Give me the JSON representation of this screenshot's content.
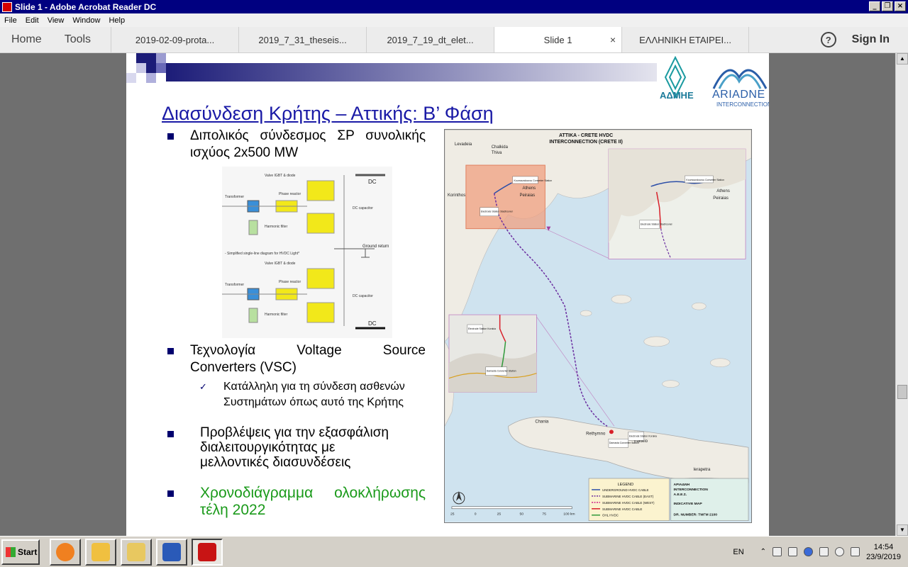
{
  "window": {
    "title": "Slide 1 - Adobe Acrobat Reader DC",
    "min": "_",
    "restore": "❐",
    "close": "×"
  },
  "menu": [
    "File",
    "Edit",
    "View",
    "Window",
    "Help"
  ],
  "tabs": {
    "home": "Home",
    "tools": "Tools",
    "docs": [
      {
        "label": "2019-02-09-prota...",
        "active": false
      },
      {
        "label": "2019_7_31_theseis...",
        "active": false
      },
      {
        "label": "2019_7_19_dt_elet...",
        "active": false
      },
      {
        "label": "Slide 1",
        "active": true
      },
      {
        "label": "ΕΛΛΗΝΙΚΗ ΕΤΑΙΡΕΙ...",
        "active": false
      }
    ],
    "close": "×",
    "help": "?",
    "sign_in": "Sign In"
  },
  "slide": {
    "title": "Διασύνδεση Κρήτης – Αττικής: Β’ Φάση",
    "logo_admie": "ΑΔΜΗΕ",
    "logo_ariadne": "ARIADNE",
    "logo_ariadne_sub": "INTERCONNECTION",
    "bullet1_l1": "Διπολικός σύνδεσμος ΣΡ συνολικής",
    "bullet1_l2": "ισχύος 2x500 MW",
    "bullet2_l1": "Τεχνολογία Voltage Source",
    "bullet2_l2": "Converters (VSC)",
    "sub1_l1": "Κατάλληλη για τη σύνδεση ασθενών",
    "sub1_l2": "Συστημάτων όπως αυτό της Κρήτης",
    "bullet3_l1": "Προβλέψεις για την εξασφάλιση",
    "bullet3_l2": "διαλειτουργικότητας με",
    "bullet3_l3": "μελλοντικές διασυνδέσεις",
    "bullet4_l1": "Χρονοδιάγραμμα ολοκλήρωσης",
    "bullet4_l2": "τέλη 2022"
  },
  "diagram": {
    "dc": "DC",
    "valve": "Valve IGBT & diode",
    "transformer": "Transformer",
    "phase_reactor": "Phase reactor",
    "harmonic_filter": "Harmonic filter",
    "dc_capacitor": "DC capacitor",
    "ground_return": "Ground return",
    "caption": "- Simplified single-line diagram for HVDC Light*"
  },
  "map": {
    "title_l1": "ATTIKA - CRETE HVDC",
    "title_l2": "INTERCONNECTION (CRETE II)",
    "places": {
      "levadeia": "Levadeia",
      "chalkida": "Chalkida",
      "thiva": "Thiva",
      "korinthos": "Korinthos",
      "athens": "Athens",
      "peiraias": "Peiraias",
      "chania": "Chania",
      "rethymno": "Rethymno",
      "irakleio": "Irakleio",
      "ierapetra": "Ierapetra"
    },
    "stations": {
      "koumoundourou": "Koumoundourou Converter Station",
      "elektrodio": "Electrode Station Stadhsonel",
      "damasta": "Damasta Converter Station",
      "pachia": "Electrode Station Korakia"
    },
    "legend_title": "LEGEND",
    "legend": [
      {
        "label": "UNDERGROUND HVDC CABLE",
        "color": "#2d4fa8",
        "dash": false
      },
      {
        "label": "SUBMARINE HVDC CABLE (EAST)",
        "color": "#6b2ea0",
        "dash": true
      },
      {
        "label": "SUBMARINE HVDC CABLE (WEST)",
        "color": "#d0208a",
        "dash": true
      },
      {
        "label": "SUBMARINE HVDC CABLE",
        "color": "#d8202a",
        "dash": false
      },
      {
        "label": "OHL HVDC",
        "color": "#2f9a3a",
        "dash": false
      }
    ],
    "info_l1": "ΑΡΙΑΔΝΗ",
    "info_l2": "INTERCONNECTION",
    "info_l3": "Α.Ε.Ε.Σ.",
    "info_l4": "INDICATIVE MAP",
    "info_l5": "DR. NUMBER: ΤΜΓΜ 2100",
    "scale": [
      "25",
      "0",
      "25",
      "50",
      "75",
      "100 km"
    ]
  },
  "taskbar": {
    "start": "Start",
    "lang": "EN",
    "time": "14:54",
    "date": "23/9/2019"
  }
}
